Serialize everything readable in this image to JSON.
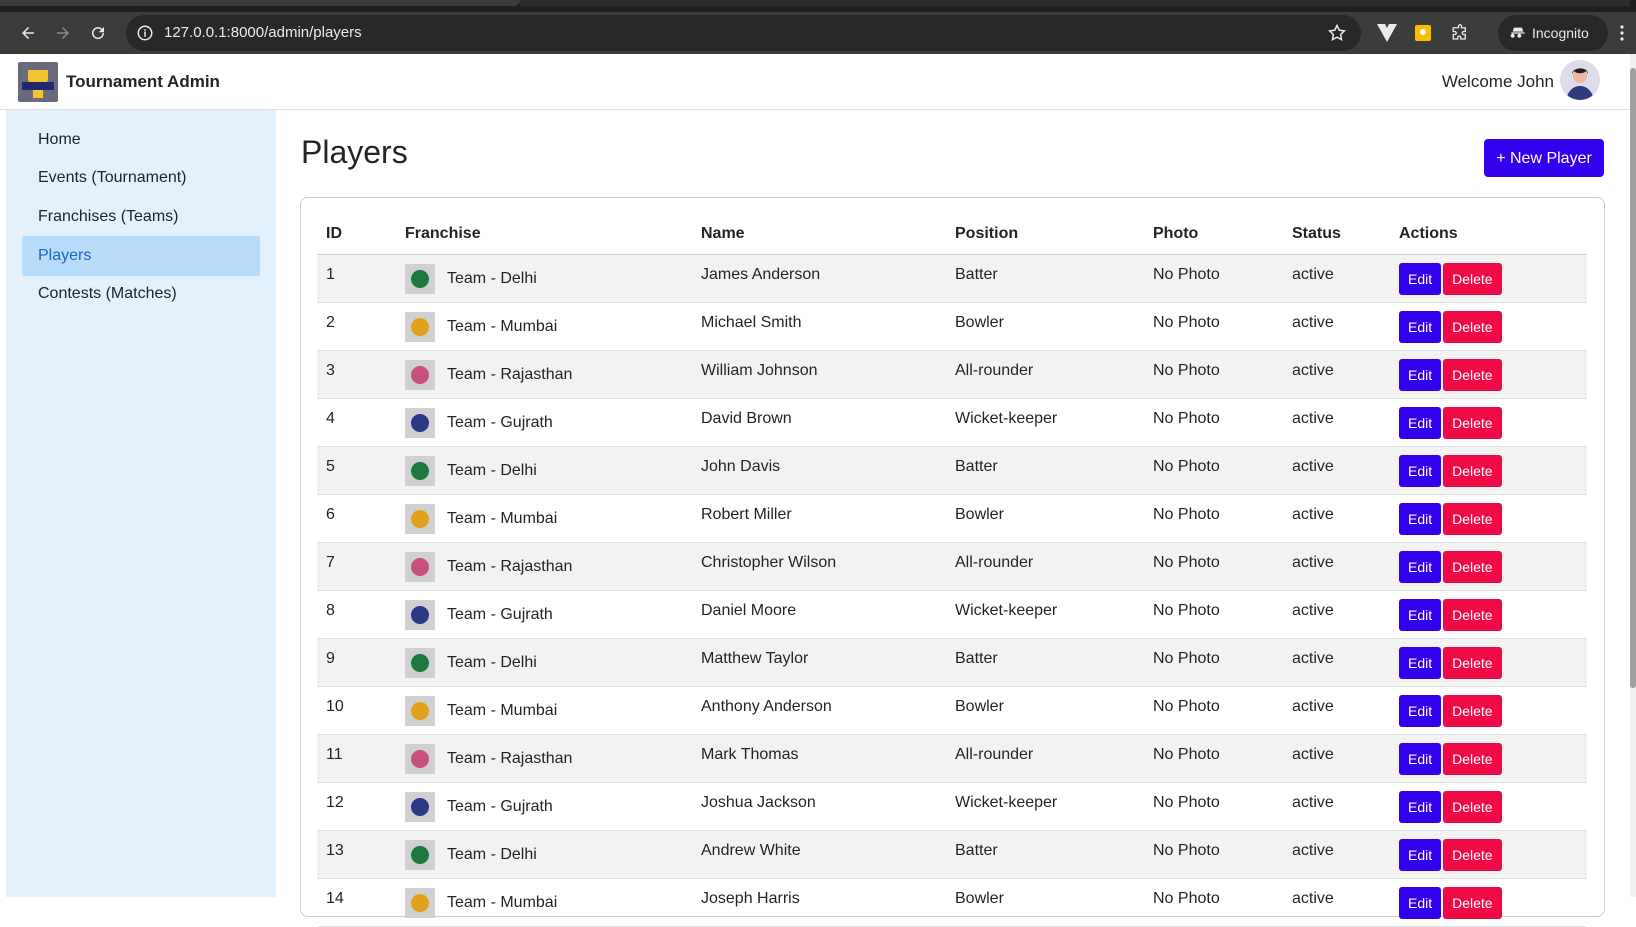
{
  "browser": {
    "url": "127.0.0.1:8000/admin/players",
    "incognito_label": "Incognito"
  },
  "header": {
    "brand": "Tournament Admin",
    "welcome": "Welcome John"
  },
  "sidebar": {
    "items": [
      {
        "label": "Home"
      },
      {
        "label": "Events (Tournament)"
      },
      {
        "label": "Franchises (Teams)"
      },
      {
        "label": "Players",
        "active": true
      },
      {
        "label": "Contests (Matches)"
      }
    ]
  },
  "main": {
    "title": "Players",
    "new_button": "+ New Player",
    "columns": [
      "ID",
      "Franchise",
      "Name",
      "Position",
      "Photo",
      "Status",
      "Actions"
    ],
    "edit_label": "Edit",
    "delete_label": "Delete",
    "rows": [
      {
        "id": "1",
        "franchise": "Team - Delhi",
        "name": "James Anderson",
        "position": "Batter",
        "photo": "No Photo",
        "status": "active"
      },
      {
        "id": "2",
        "franchise": "Team - Mumbai",
        "name": "Michael Smith",
        "position": "Bowler",
        "photo": "No Photo",
        "status": "active"
      },
      {
        "id": "3",
        "franchise": "Team - Rajasthan",
        "name": "William Johnson",
        "position": "All-rounder",
        "photo": "No Photo",
        "status": "active"
      },
      {
        "id": "4",
        "franchise": "Team - Gujrath",
        "name": "David Brown",
        "position": "Wicket-keeper",
        "photo": "No Photo",
        "status": "active"
      },
      {
        "id": "5",
        "franchise": "Team - Delhi",
        "name": "John Davis",
        "position": "Batter",
        "photo": "No Photo",
        "status": "active"
      },
      {
        "id": "6",
        "franchise": "Team - Mumbai",
        "name": "Robert Miller",
        "position": "Bowler",
        "photo": "No Photo",
        "status": "active"
      },
      {
        "id": "7",
        "franchise": "Team - Rajasthan",
        "name": "Christopher Wilson",
        "position": "All-rounder",
        "photo": "No Photo",
        "status": "active"
      },
      {
        "id": "8",
        "franchise": "Team - Gujrath",
        "name": "Daniel Moore",
        "position": "Wicket-keeper",
        "photo": "No Photo",
        "status": "active"
      },
      {
        "id": "9",
        "franchise": "Team - Delhi",
        "name": "Matthew Taylor",
        "position": "Batter",
        "photo": "No Photo",
        "status": "active"
      },
      {
        "id": "10",
        "franchise": "Team - Mumbai",
        "name": "Anthony Anderson",
        "position": "Bowler",
        "photo": "No Photo",
        "status": "active"
      },
      {
        "id": "11",
        "franchise": "Team - Rajasthan",
        "name": "Mark Thomas",
        "position": "All-rounder",
        "photo": "No Photo",
        "status": "active"
      },
      {
        "id": "12",
        "franchise": "Team - Gujrath",
        "name": "Joshua Jackson",
        "position": "Wicket-keeper",
        "photo": "No Photo",
        "status": "active"
      },
      {
        "id": "13",
        "franchise": "Team - Delhi",
        "name": "Andrew White",
        "position": "Batter",
        "photo": "No Photo",
        "status": "active"
      },
      {
        "id": "14",
        "franchise": "Team - Mumbai",
        "name": "Joseph Harris",
        "position": "Bowler",
        "photo": "No Photo",
        "status": "active"
      }
    ]
  },
  "colors": {
    "primary": "#3300ee",
    "danger": "#ee0a45",
    "sidebar_bg": "#e3f1fd",
    "sidebar_active": "#b8dcfa"
  }
}
